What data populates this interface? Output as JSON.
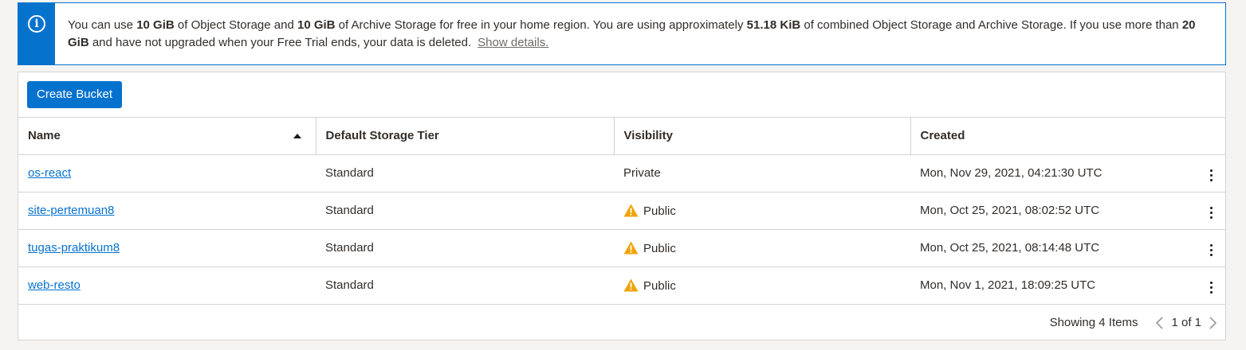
{
  "notice": {
    "icon": "info-icon",
    "accent": "#0572ce",
    "t1": "You can use ",
    "b1": "10 GiB",
    "t2": " of Object Storage and ",
    "b2": "10 GiB",
    "t3": " of Archive Storage for free in your home region. You are using approximately ",
    "b3": "51.18 KiB",
    "t4": " of combined Object Storage and Archive Storage. If you use more than ",
    "b4": "20 GiB",
    "t5": " and have not upgraded when your Free Trial ends, your data is deleted.",
    "link": "Show details."
  },
  "toolbar": {
    "create_label": "Create Bucket"
  },
  "table": {
    "columns": [
      "Name",
      "Default Storage Tier",
      "Visibility",
      "Created"
    ],
    "sort_icon": "sort-ascending-icon",
    "rows": [
      {
        "name": "os-react",
        "tier": "Standard",
        "visibility": "Private",
        "warning": false,
        "created": "Mon, Nov 29, 2021, 04:21:30 UTC"
      },
      {
        "name": "site-pertemuan8",
        "tier": "Standard",
        "visibility": "Public",
        "warning": true,
        "created": "Mon, Oct 25, 2021, 08:02:52 UTC"
      },
      {
        "name": "tugas-praktikum8",
        "tier": "Standard",
        "visibility": "Public",
        "warning": true,
        "created": "Mon, Oct 25, 2021, 08:14:48 UTC"
      },
      {
        "name": "web-resto",
        "tier": "Standard",
        "visibility": "Public",
        "warning": true,
        "created": "Mon, Nov 1, 2021, 18:09:25 UTC"
      }
    ]
  },
  "footer": {
    "showing": "Showing 4 Items",
    "page": "1 of 1"
  },
  "colors": {
    "link": "#0572ce",
    "warning": "#f0a30a"
  }
}
